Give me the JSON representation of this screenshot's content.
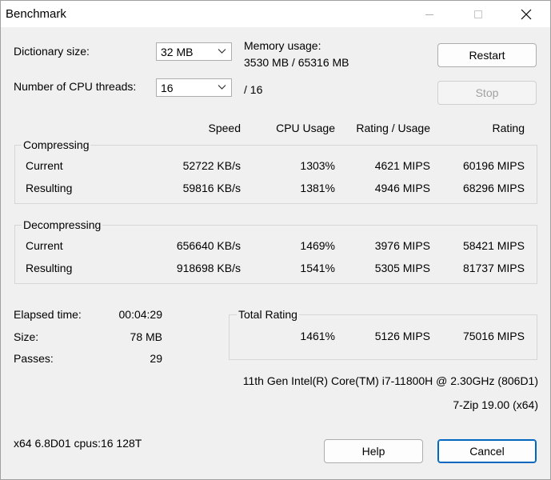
{
  "window": {
    "title": "Benchmark"
  },
  "settings": {
    "dict_label": "Dictionary size:",
    "dict_value": "32 MB",
    "threads_label": "Number of CPU threads:",
    "threads_value": "16",
    "threads_max": "/ 16",
    "mem_label": "Memory usage:",
    "mem_value": "3530 MB / 65316 MB"
  },
  "buttons": {
    "restart": "Restart",
    "stop": "Stop",
    "help": "Help",
    "cancel": "Cancel"
  },
  "columns": {
    "speed": "Speed",
    "cpu": "CPU Usage",
    "rating_usage": "Rating / Usage",
    "rating": "Rating"
  },
  "compressing": {
    "label": "Compressing",
    "rows": [
      {
        "name": "Current",
        "speed": "52722 KB/s",
        "cpu": "1303%",
        "ru": "4621 MIPS",
        "rating": "60196 MIPS"
      },
      {
        "name": "Resulting",
        "speed": "59816 KB/s",
        "cpu": "1381%",
        "ru": "4946 MIPS",
        "rating": "68296 MIPS"
      }
    ]
  },
  "decompressing": {
    "label": "Decompressing",
    "rows": [
      {
        "name": "Current",
        "speed": "656640 KB/s",
        "cpu": "1469%",
        "ru": "3976 MIPS",
        "rating": "58421 MIPS"
      },
      {
        "name": "Resulting",
        "speed": "918698 KB/s",
        "cpu": "1541%",
        "ru": "5305 MIPS",
        "rating": "81737 MIPS"
      }
    ]
  },
  "stats": {
    "elapsed_label": "Elapsed time:",
    "elapsed_value": "00:04:29",
    "size_label": "Size:",
    "size_value": "78 MB",
    "passes_label": "Passes:",
    "passes_value": "29"
  },
  "total": {
    "label": "Total Rating",
    "cpu": "1461%",
    "ru": "5126 MIPS",
    "rating": "75016 MIPS"
  },
  "system": {
    "cpu_name": "11th Gen Intel(R) Core(TM) i7-11800H @ 2.30GHz (806D1)",
    "version": "7-Zip 19.00 (x64)",
    "arch": "x64 6.8D01 cpus:16 128T"
  },
  "icons": {
    "minimize": "minimize-icon",
    "maximize": "maximize-icon",
    "close": "close-icon",
    "dropdown": "chevron-down-icon"
  }
}
